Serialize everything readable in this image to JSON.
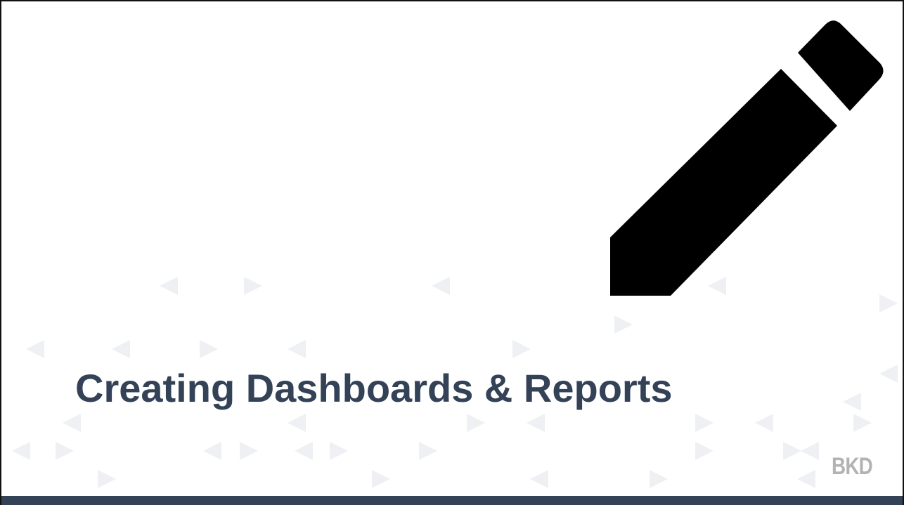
{
  "slide": {
    "title": "Creating Dashboards & Reports",
    "logo_text": "BKD",
    "icon": "pencil-icon"
  },
  "colors": {
    "title": "#344257",
    "footer_bar": "#344257",
    "logo": "#b3b3b3",
    "pattern": "#eef0f3",
    "icon": "#000000"
  }
}
